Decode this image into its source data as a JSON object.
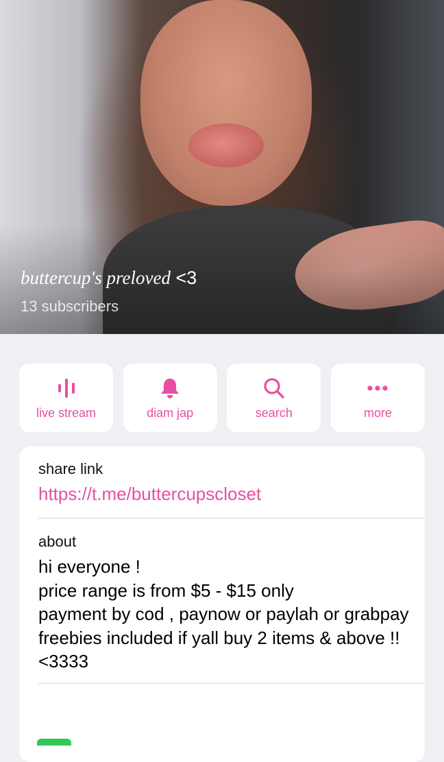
{
  "header": {
    "title_script": "buttercup's preloved",
    "title_tail": "<3",
    "subscribers": "13 subscribers"
  },
  "actions": [
    {
      "label": "live stream",
      "icon": "live-stream-icon"
    },
    {
      "label": "diam jap",
      "icon": "bell-icon"
    },
    {
      "label": "search",
      "icon": "search-icon"
    },
    {
      "label": "more",
      "icon": "more-dots-icon"
    }
  ],
  "info": {
    "share_caption": "share link",
    "share_link": "https://t.me/buttercupscloset",
    "about_caption": "about",
    "about_text": "hi everyone !\nprice range is from $5 - $15 only\npayment by cod , paynow or paylah or grabpay\nfreebies included if yall buy 2 items & above !!\n<3333"
  },
  "colors": {
    "accent": "#e84fa2",
    "background": "#efeff4",
    "card": "#ffffff",
    "toggle_on": "#34c759"
  }
}
